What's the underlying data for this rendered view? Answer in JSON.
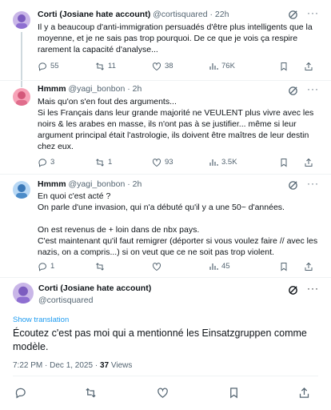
{
  "posts": [
    {
      "name": "Corti (Josiane hate account)",
      "handle": "@cortisquared",
      "time": "· 22h",
      "lines": [
        "Il y a beaucoup d'anti-immigration persuadés d'être plus intelligents que la",
        "moyenne, et je ne sais pas trop pourquoi. De ce que je vois ça respire",
        "rarement la capacité d'analyse..."
      ],
      "replies": "55",
      "reposts": "11",
      "likes": "38",
      "views": "76K"
    },
    {
      "name": "Hmmm",
      "handle": "@yagi_bonbon",
      "time": "· 2h",
      "lines": [
        "Mais qu'on s'en fout des arguments...",
        "Si les Français dans leur grande majorité ne VEULENT plus vivre avec les",
        "noirs & les arabes en masse, ils n'ont pas à se justifier... même si leur",
        "argument principal était l'astrologie, ils doivent être maîtres de leur destin",
        "chez eux."
      ],
      "replies": "3",
      "reposts": "1",
      "likes": "93",
      "views": "3.5K"
    },
    {
      "name": "Hmmm",
      "handle": "@yagi_bonbon",
      "time": "· 2h",
      "lines": [
        "En quoi c'est acté ?",
        "On parle d'une invasion, qui n'a débuté qu'il y a une 50~ d'années.",
        "",
        "On est revenus de + loin dans de nbx pays.",
        "C'est maintenant qu'il faut remigrer (déporter si vous voulez faire // avec les",
        "nazis, on a compris...) si on veut que ce ne soit pas trop violent."
      ],
      "replies": "1",
      "reposts": "",
      "likes": "",
      "views": "45"
    }
  ],
  "main_post": {
    "name": "Corti (Josiane hate account)",
    "handle": "@cortisquared",
    "translate_label": "Show translation",
    "lines": [
      "Écoutez c'est pas moi qui a mentionné les Einsatzgruppen comme",
      "modèle."
    ],
    "timestamp": "7:22 PM · Dec 1, 2025 · ",
    "views_count": "37",
    "views_label": " Views"
  },
  "colors": {
    "text": "#0f1419",
    "secondary": "#536471",
    "link": "#1d9bf0",
    "divider": "#eff3f4"
  },
  "icons": [
    "reply-icon",
    "repost-icon",
    "like-icon",
    "views-icon",
    "bookmark-icon",
    "share-icon",
    "grok-icon",
    "more-icon"
  ]
}
